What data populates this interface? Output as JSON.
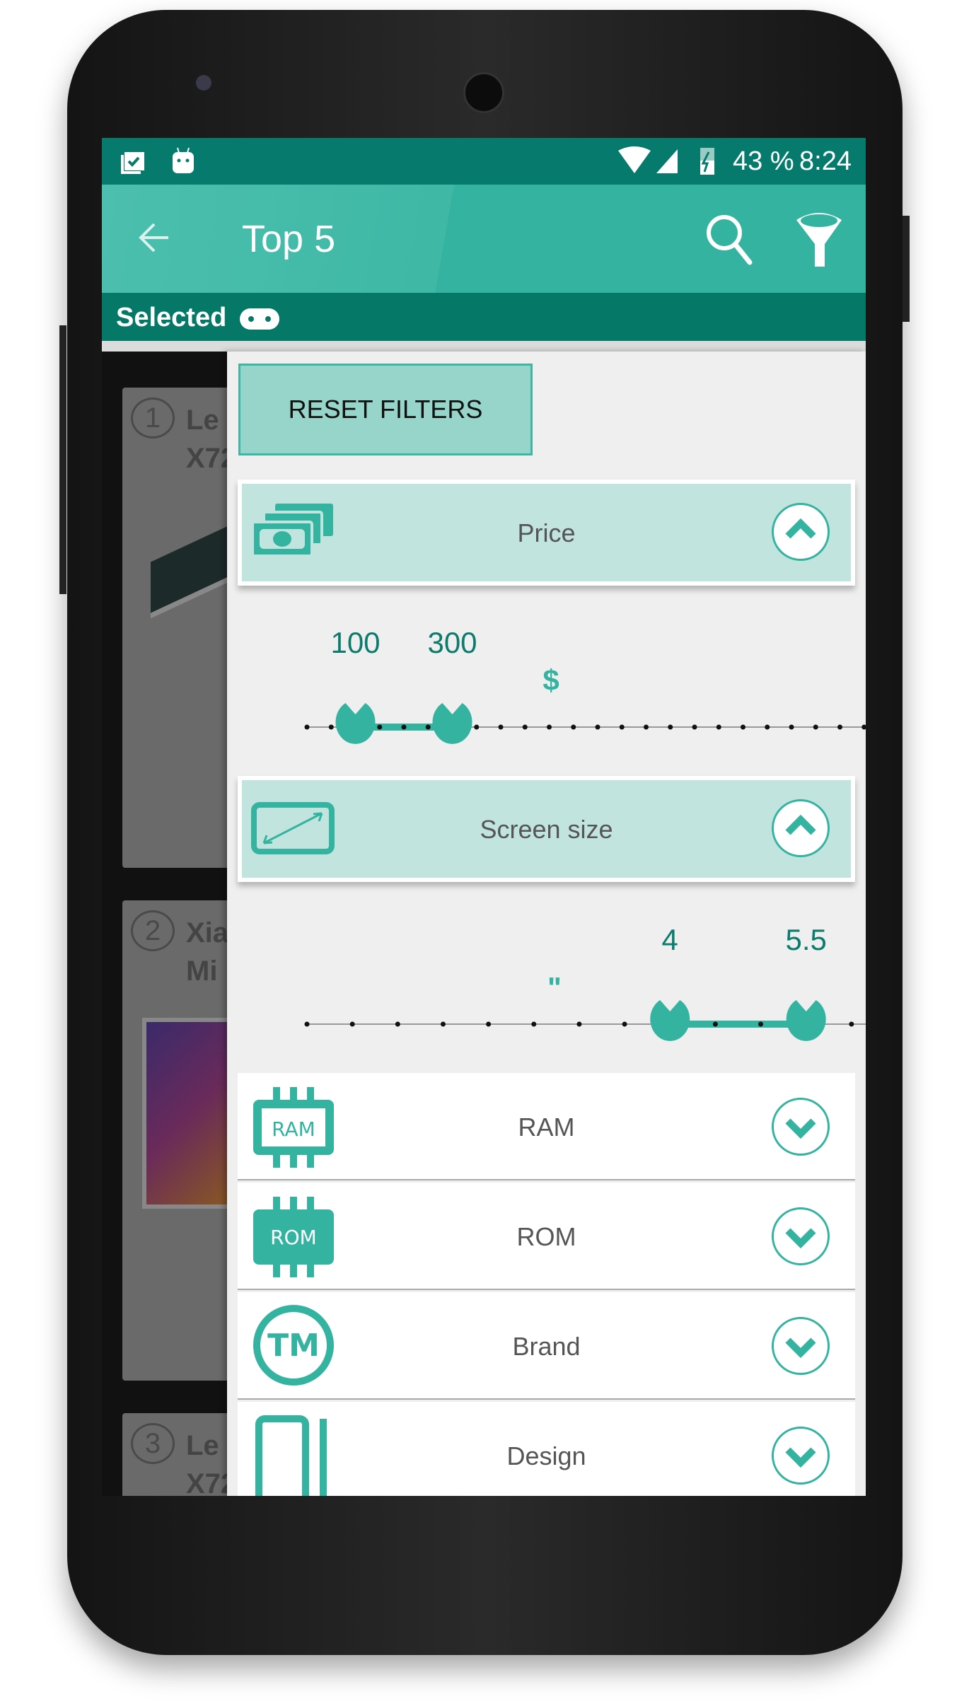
{
  "status_bar": {
    "battery": "43 %",
    "time": "8:24",
    "icons": [
      "clipboard-check-icon",
      "android-icon",
      "wifi-icon",
      "signal-icon",
      "battery-charging-icon"
    ]
  },
  "toolbar": {
    "title": "Top 5",
    "icons": [
      "back-arrow-icon",
      "search-icon",
      "filter-icon"
    ]
  },
  "selected_bar": {
    "label": "Selected",
    "icon": "gamepad-icon"
  },
  "background_list": [
    {
      "rank": "1",
      "title_lines": [
        "Le",
        "X72"
      ]
    },
    {
      "rank": "2",
      "title_lines": [
        "Xia",
        "Mi"
      ]
    },
    {
      "rank": "3",
      "title_lines": [
        "Le",
        "X72"
      ]
    }
  ],
  "filters": {
    "reset_label": "RESET FILTERS",
    "price": {
      "label": "Price",
      "unit": "$",
      "min": 0,
      "max": 1200,
      "step": 50,
      "low": 100,
      "high": 300,
      "low_label": "100",
      "high_label": "300",
      "expanded": true,
      "icon": "money-icon"
    },
    "screen_size": {
      "label": "Screen size",
      "unit": "\"",
      "min": 0,
      "max": 6.5,
      "step": 0.5,
      "low": 4,
      "high": 5.5,
      "low_label": "4",
      "high_label": "5.5",
      "expanded": true,
      "icon": "screen-diagonal-icon"
    },
    "collapsed": [
      {
        "label": "RAM",
        "icon": "ram-chip-icon",
        "icon_text": "RAM"
      },
      {
        "label": "ROM",
        "icon": "rom-chip-icon",
        "icon_text": "ROM"
      },
      {
        "label": "Brand",
        "icon": "trademark-icon",
        "icon_text": "TM"
      },
      {
        "label": "Design",
        "icon": "phone-design-icon"
      }
    ]
  },
  "colors": {
    "accent": "#33b3a0",
    "dark": "#067a6c",
    "header_bg": "#c2e4de",
    "value_text": "#0d7b6d"
  }
}
